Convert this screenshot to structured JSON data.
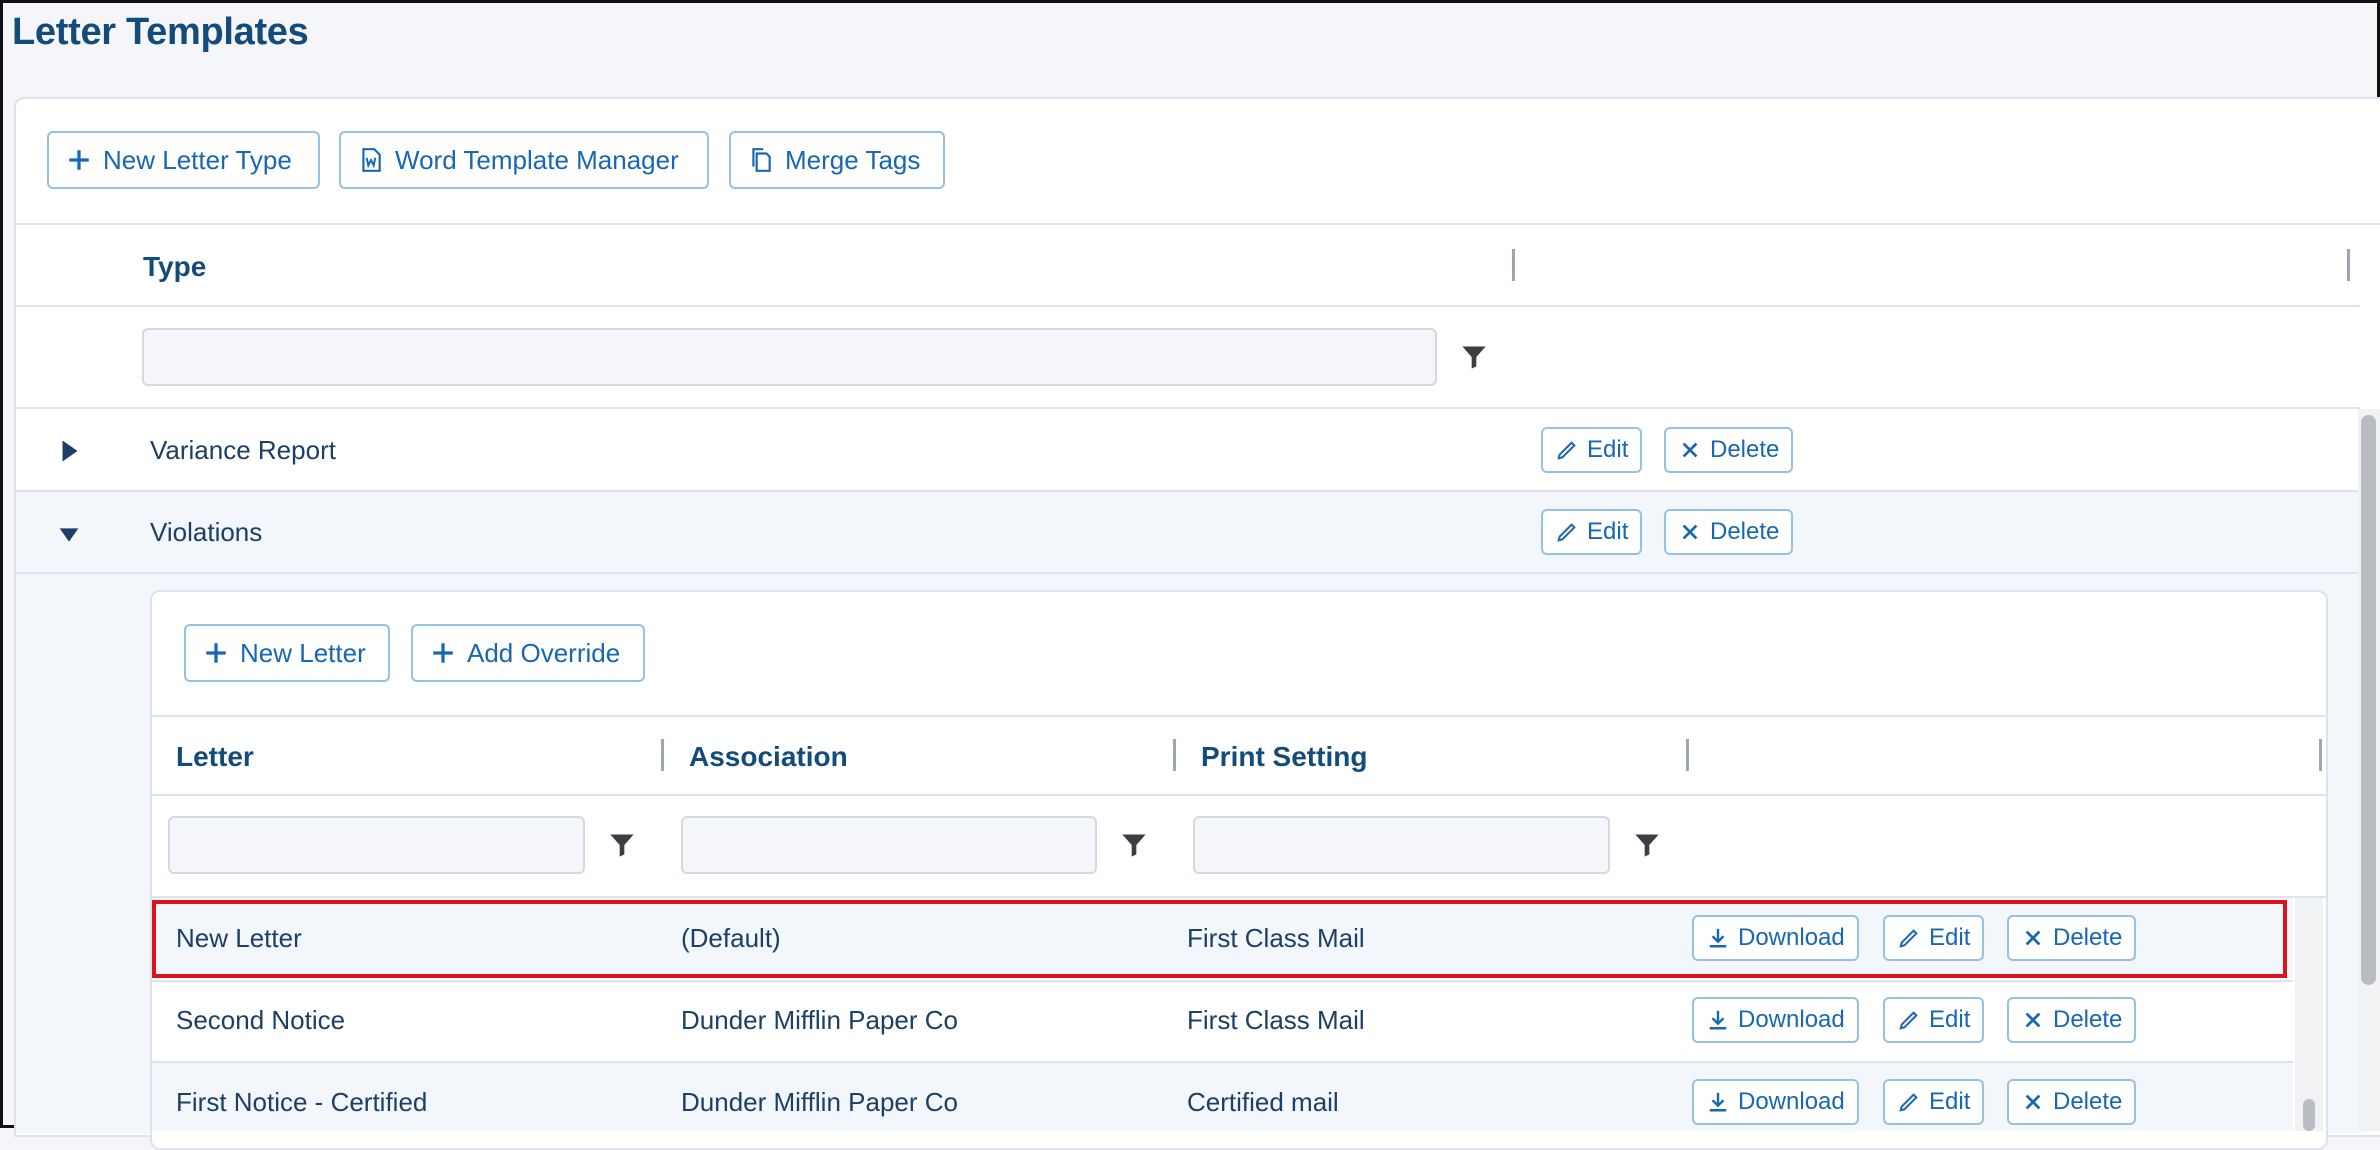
{
  "page": {
    "title": "Letter Templates"
  },
  "toolbar": {
    "new_letter_type": "New Letter Type",
    "word_template_manager": "Word Template Manager",
    "merge_tags": "Merge Tags"
  },
  "types_table": {
    "header": "Type",
    "filter_value": "",
    "rows": [
      {
        "type": "Variance Report",
        "expanded": false,
        "edit": "Edit",
        "delete": "Delete"
      },
      {
        "type": "Violations",
        "expanded": true,
        "edit": "Edit",
        "delete": "Delete"
      }
    ]
  },
  "letters_panel": {
    "new_letter": "New Letter",
    "add_override": "Add Override",
    "columns": [
      "Letter",
      "Association",
      "Print Setting"
    ],
    "rows": [
      {
        "letter": "New Letter",
        "association": "(Default)",
        "print_setting": "First Class Mail",
        "selected": true
      },
      {
        "letter": "Second Notice",
        "association": "Dunder Mifflin Paper Co",
        "print_setting": "First Class Mail",
        "selected": false
      },
      {
        "letter": "First Notice - Certified",
        "association": "Dunder Mifflin Paper Co",
        "print_setting": "Certified mail",
        "selected": false
      }
    ],
    "actions": {
      "download": "Download",
      "edit": "Edit",
      "delete": "Delete"
    }
  },
  "icons": {
    "plus": "plus-icon",
    "word": "word-doc-icon",
    "copy": "copy-icon",
    "filter": "filter-icon",
    "pencil": "pencil-icon",
    "close": "close-icon",
    "download": "download-icon",
    "caret_right": "caret-right-icon",
    "caret_down": "caret-down-icon"
  },
  "colors": {
    "accent": "#1767b3",
    "selected_border": "#d9141d",
    "title": "#134b7a"
  }
}
